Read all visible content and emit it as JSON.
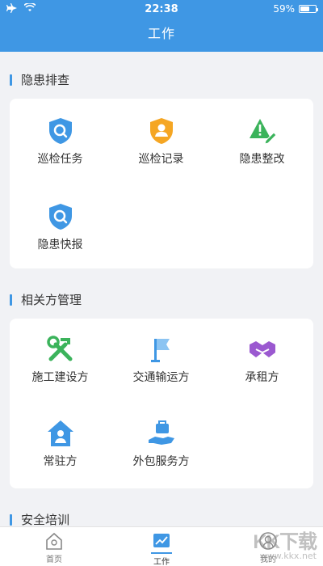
{
  "status_bar": {
    "time": "22:38",
    "battery": "59%",
    "battery_level": 0.59
  },
  "header": {
    "title": "工作"
  },
  "sections": [
    {
      "title": "隐患排查",
      "items": [
        {
          "label": "巡检任务",
          "icon": "shield-search-icon"
        },
        {
          "label": "巡检记录",
          "icon": "shield-person-icon"
        },
        {
          "label": "隐患整改",
          "icon": "warning-edit-icon"
        },
        {
          "label": "隐患快报",
          "icon": "shield-search-icon"
        }
      ]
    },
    {
      "title": "相关方管理",
      "items": [
        {
          "label": "施工建设方",
          "icon": "wrench-hammer-icon"
        },
        {
          "label": "交通输运方",
          "icon": "flag-icon"
        },
        {
          "label": "承租方",
          "icon": "handshake-icon"
        },
        {
          "label": "常驻方",
          "icon": "house-person-icon"
        },
        {
          "label": "外包服务方",
          "icon": "hand-briefcase-icon"
        }
      ]
    },
    {
      "title": "安全培训"
    }
  ],
  "tabbar": [
    {
      "label": "首页",
      "icon": "home-icon",
      "active": false
    },
    {
      "label": "工作",
      "icon": "chart-icon",
      "active": true
    },
    {
      "label": "我的",
      "icon": "person-icon",
      "active": false
    }
  ],
  "watermark": {
    "big": "KK下载",
    "small": "www.kkx.net"
  },
  "colors": {
    "primary": "#3f97e4",
    "orange": "#f5a623",
    "green": "#3bb35b",
    "purple": "#9b59d0"
  }
}
